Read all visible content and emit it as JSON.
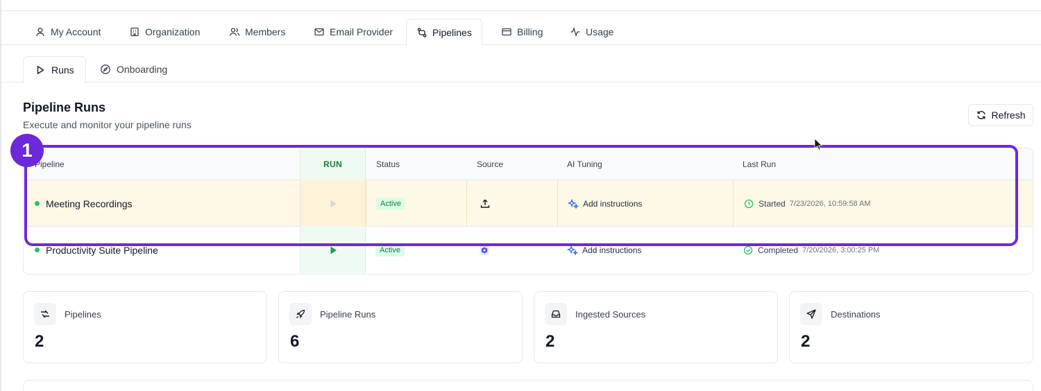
{
  "main_tabs": [
    {
      "label": "My Account",
      "icon": "user-icon",
      "active": false
    },
    {
      "label": "Organization",
      "icon": "building-icon",
      "active": false
    },
    {
      "label": "Members",
      "icon": "users-icon",
      "active": false
    },
    {
      "label": "Email Provider",
      "icon": "mail-icon",
      "active": false
    },
    {
      "label": "Pipelines",
      "icon": "pipeline-icon",
      "active": true
    },
    {
      "label": "Billing",
      "icon": "credit-card-icon",
      "active": false
    },
    {
      "label": "Usage",
      "icon": "activity-icon",
      "active": false
    }
  ],
  "sub_tabs": [
    {
      "label": "Runs",
      "icon": "play-icon",
      "active": true
    },
    {
      "label": "Onboarding",
      "icon": "compass-icon",
      "active": false
    }
  ],
  "section": {
    "title": "Pipeline Runs",
    "subtitle": "Execute and monitor your pipeline runs",
    "refresh_label": "Refresh"
  },
  "table": {
    "headers": {
      "pipeline": "Pipeline",
      "run": "RUN",
      "status": "Status",
      "source": "Source",
      "ai_tuning": "AI Tuning",
      "last_run": "Last Run"
    },
    "rows": [
      {
        "name": "Meeting Recordings",
        "status": "Active",
        "source_icon": "upload-icon",
        "ai_tuning": "Add instructions",
        "last_run_label": "Started",
        "last_run_time": "7/23/2026, 10:59:58 AM",
        "run_enabled": false
      },
      {
        "name": "Productivity Suite Pipeline",
        "status": "Active",
        "source_icon": "cloud-app-icon",
        "ai_tuning": "Add instructions",
        "last_run_label": "Completed",
        "last_run_time": "7/20/2026, 3:00:25 PM",
        "run_enabled": true
      }
    ]
  },
  "highlight": {
    "label": "1",
    "color": "#6d28d9"
  },
  "stats": [
    {
      "label": "Pipelines",
      "value": "2",
      "icon": "pipelines-icon"
    },
    {
      "label": "Pipeline Runs",
      "value": "6",
      "icon": "rocket-icon"
    },
    {
      "label": "Ingested Sources",
      "value": "2",
      "icon": "inbox-icon"
    },
    {
      "label": "Destinations",
      "value": "2",
      "icon": "send-icon"
    }
  ],
  "colors": {
    "accent": "#6d28d9",
    "active_green": "#15803d",
    "dot_green": "#22c55e",
    "highlight_row": "#fef8e7"
  }
}
